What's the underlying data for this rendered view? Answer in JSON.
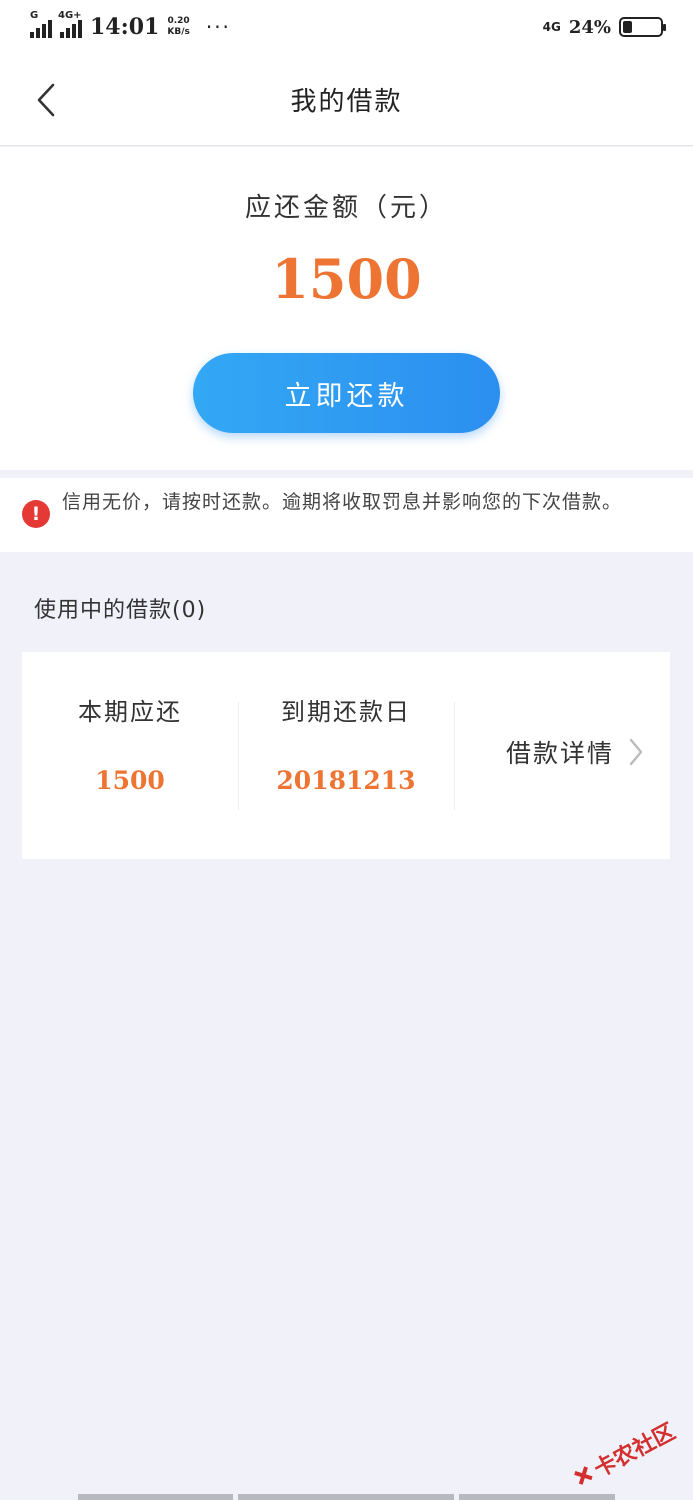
{
  "status_bar": {
    "net_tag": "G",
    "net_tag_2": "4G+",
    "time": "14:01",
    "speed_value": "0.20",
    "speed_unit": "KB/s",
    "more": "···",
    "net_right": "4G",
    "battery_percent": "24%",
    "battery_level": 0.24
  },
  "nav": {
    "title": "我的借款"
  },
  "amount": {
    "label": "应还金额（元）",
    "value": "1500",
    "repay_button": "立即还款",
    "button_color": "#2b8ff0",
    "amount_color": "#ee7433"
  },
  "notice": {
    "icon": "!",
    "text": "信用无价，请按时还款。逾期将收取罚息并影响您的下次借款。"
  },
  "loans": {
    "section_title": "使用中的借款(0)",
    "columns": [
      {
        "label": "本期应还",
        "value": "1500"
      },
      {
        "label": "到期还款日",
        "value": "20181213"
      }
    ],
    "detail_label": "借款详情"
  },
  "watermark": {
    "text": "卡农社区"
  }
}
